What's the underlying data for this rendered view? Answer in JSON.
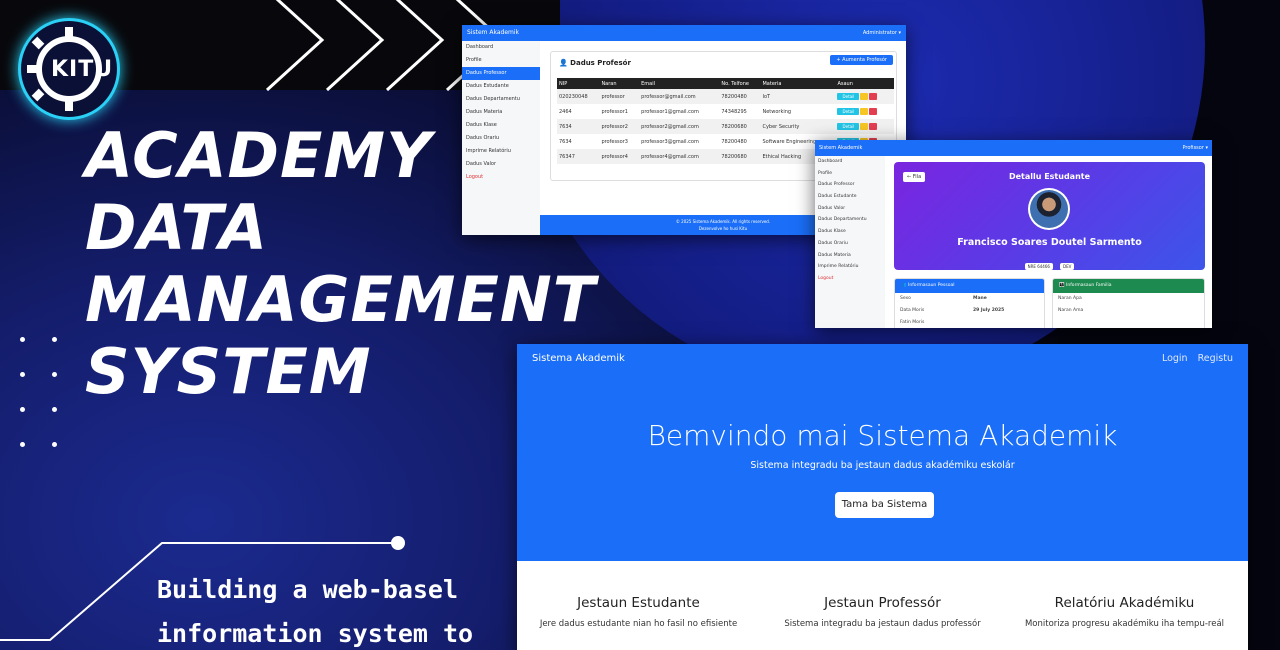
{
  "logo": {
    "text": "KITU",
    "accent": "#2ad0f5"
  },
  "headline": [
    "ACADEMY",
    "DATA",
    "MANAGEMENT",
    "SYSTEM"
  ],
  "subtitle": [
    "Building a web-basel",
    "information system to"
  ],
  "professor_screen": {
    "brand": "Sistem Akademik",
    "user": "Administrator ▾",
    "sidebar": [
      "Dashboard",
      "Profile",
      "Dadus Professor",
      "Dadus Estudante",
      "Dadus Departamentu",
      "Dadus Materia",
      "Dadus Klase",
      "Dadus Orariu",
      "Imprime Relatóriu",
      "Dadus Valor",
      "Logout"
    ],
    "active_index": 2,
    "card_title": "Dadus Profesór",
    "add_button": "+ Aumenta Profesór",
    "columns": [
      "NIP",
      "Naran",
      "Email",
      "No. Telfone",
      "Materia",
      "Asaun"
    ],
    "rows": [
      [
        "020230048",
        "professor",
        "professor@gmail.com",
        "78200480",
        "IoT"
      ],
      [
        "2464",
        "professor1",
        "professor1@gmail.com",
        "74348295",
        "Networking"
      ],
      [
        "7634",
        "professor2",
        "professor2@gmail.com",
        "78200680",
        "Cyber Security"
      ],
      [
        "7634",
        "professor3",
        "professor3@gmail.com",
        "78200480",
        "Software Engineering"
      ],
      [
        "76347",
        "professor4",
        "professor4@gmail.com",
        "78200680",
        "Ethical Hacking"
      ]
    ],
    "detail_label": "Detail",
    "footer": [
      "© 2025 Sistema Akademik. All rights reserved.",
      "Dezenvolve ho husi Kitu"
    ]
  },
  "student_screen": {
    "brand": "Sistem Akademik",
    "user": "Profissor ▾",
    "sidebar": [
      "Dashboard",
      "Profile",
      "Dadus Professor",
      "Dadus Estudante",
      "Dadus Valor",
      "Dadus Departamentu",
      "Dadus Klase",
      "Dadus Orariu",
      "Dadus Materia",
      "Imprime Relatóriu",
      "Logout"
    ],
    "back": "← Fila",
    "title": "Detallu Estudante",
    "name": "Francisco Soares Doutel Sarmento",
    "badges": [
      "NRE 64466",
      "DEV"
    ],
    "panel_personal": {
      "title": "Informasaun Pessoal",
      "color": "#1a6ef7",
      "rows": [
        [
          "Sexo",
          "Mane"
        ],
        [
          "Data Moris",
          "29 July 2025"
        ],
        [
          "Fatin Moris",
          ""
        ]
      ]
    },
    "panel_family": {
      "title": "Informasaun Familia",
      "color": "#1d8a4f",
      "rows": [
        [
          "Naran Apa",
          ""
        ],
        [
          "Naran Ama",
          ""
        ]
      ]
    }
  },
  "landing_screen": {
    "brand": "Sistema Akademik",
    "links": [
      "Login",
      "Registu"
    ],
    "title": "Bemvindo mai Sistema Akademik",
    "lead": "Sistema integradu ba jestaun dadus akadémiku eskolár",
    "cta": "Tama ba Sistema",
    "features": [
      {
        "title": "Jestaun Estudante",
        "desc": "Jere dadus estudante nian ho fasil no efisiente"
      },
      {
        "title": "Jestaun Professór",
        "desc": "Sistema integradu ba jestaun dadus professór"
      },
      {
        "title": "Relatóriu Akadémiku",
        "desc": "Monitoriza progresu akadémiku iha tempu-reál"
      }
    ]
  }
}
